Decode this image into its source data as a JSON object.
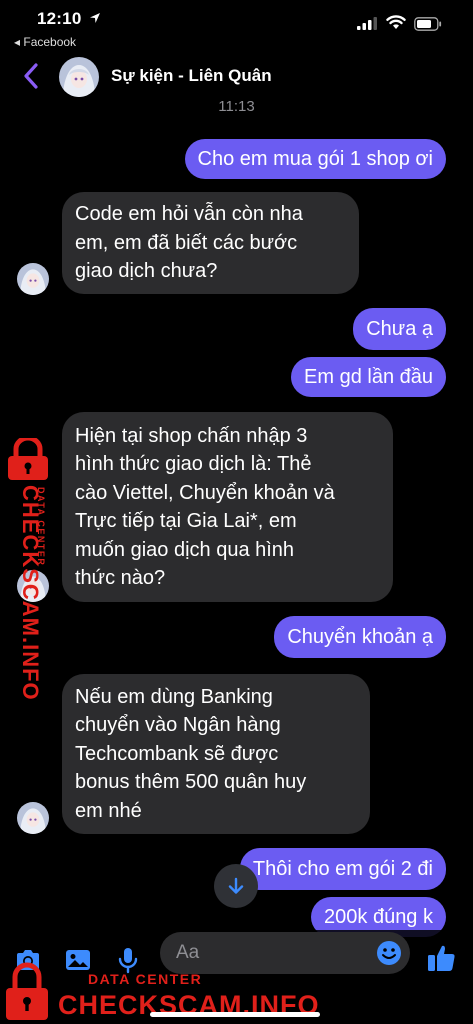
{
  "status_bar": {
    "time": "12:10",
    "back_app": "◂ Facebook"
  },
  "header": {
    "title": "Sự kiện - Liên Quân"
  },
  "timestamp": "11:13",
  "messages": [
    {
      "dir": "out",
      "text": "Cho em mua gói 1 shop ơi"
    },
    {
      "dir": "in",
      "text": "Code em hỏi vẫn còn nha\nem, em đã biết các bước\ngiao dịch chưa?"
    },
    {
      "dir": "out",
      "text": "Chưa ạ"
    },
    {
      "dir": "out",
      "text": "Em gd lần đầu"
    },
    {
      "dir": "in",
      "text": "Hiện tại shop chấn nhập 3\nhình thức giao dịch là: Thẻ\ncào Viettel, Chuyển khoản và\nTrực tiếp tại Gia Lai*, em\nmuốn giao dịch qua hình\nthức nào?"
    },
    {
      "dir": "out",
      "text": "Chuyển khoản ạ"
    },
    {
      "dir": "in",
      "text": "Nếu em dùng Banking\nchuyển vào Ngân hàng\nTechcombank sẽ được\nbonus thêm 500 quân huy\nem nhé"
    },
    {
      "dir": "out",
      "text": "Thôi cho em gói 2 đi"
    },
    {
      "dir": "out",
      "text": "200k đúng k"
    }
  ],
  "composer": {
    "placeholder": "Aa"
  },
  "watermark": {
    "main": "CHECKSCAM.INFO",
    "sub": "DATA CENTER"
  },
  "colors": {
    "accent": "#7b5cf5",
    "incoming_bubble": "#2c2c2e",
    "icon_blue": "#3d8bfd",
    "watermark_red": "#e0201a"
  }
}
